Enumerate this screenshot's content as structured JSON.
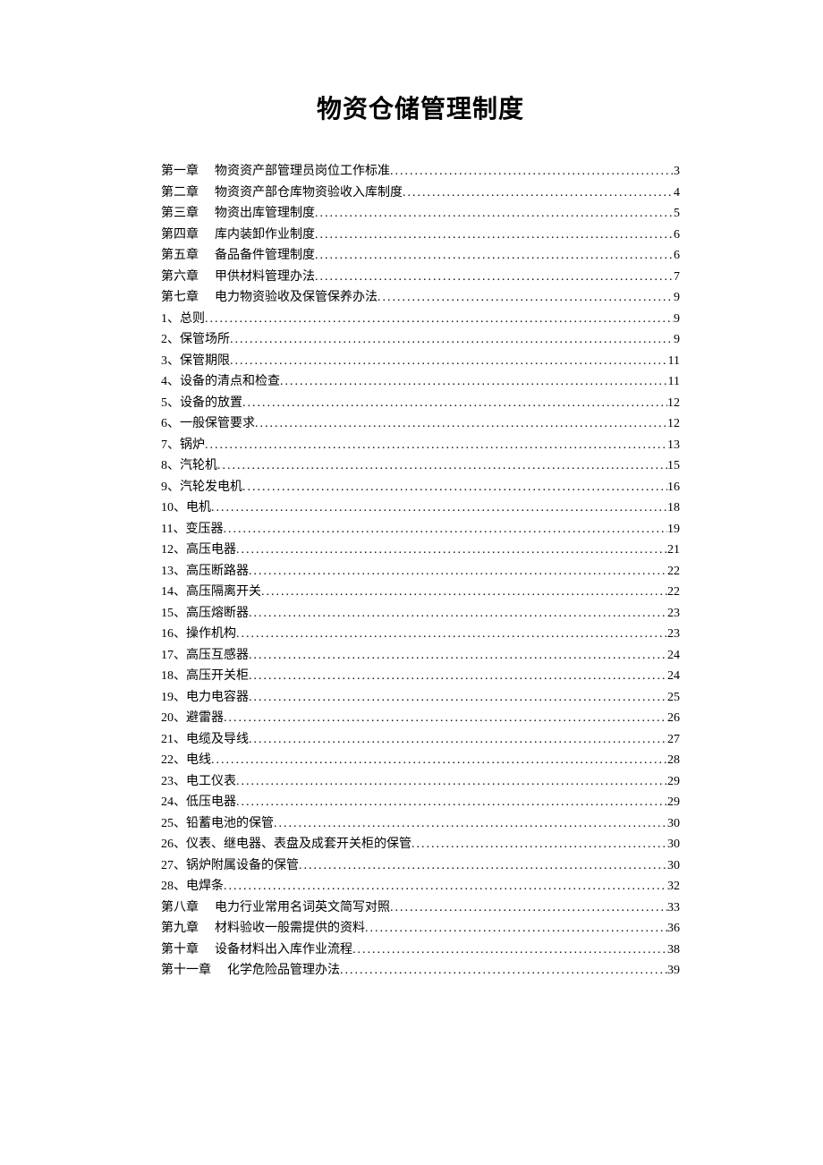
{
  "title": "物资仓储管理制度",
  "toc": [
    {
      "label": "第一章",
      "text": "物资资产部管理员岗位工作标准",
      "page": "3",
      "isChapter": true
    },
    {
      "label": "第二章",
      "text": "物资资产部仓库物资验收入库制度",
      "page": "4",
      "isChapter": true
    },
    {
      "label": "第三章",
      "text": "物资出库管理制度",
      "page": "5",
      "isChapter": true
    },
    {
      "label": "第四章",
      "text": "库内装卸作业制度",
      "page": "6",
      "isChapter": true
    },
    {
      "label": "第五章",
      "text": "备品备件管理制度",
      "page": "6",
      "isChapter": true
    },
    {
      "label": "第六章",
      "text": "甲供材料管理办法",
      "page": "7",
      "isChapter": true
    },
    {
      "label": "第七章",
      "text": "电力物资验收及保管保养办法",
      "page": "9",
      "isChapter": true
    },
    {
      "label": "1、",
      "text": "总则",
      "page": "9",
      "isChapter": false
    },
    {
      "label": "2、",
      "text": "保管场所",
      "page": "9",
      "isChapter": false
    },
    {
      "label": "3、",
      "text": "保管期限",
      "page": "11",
      "isChapter": false
    },
    {
      "label": "4、",
      "text": "设备的清点和检查",
      "page": "11",
      "isChapter": false
    },
    {
      "label": "5、",
      "text": "设备的放置",
      "page": "12",
      "isChapter": false
    },
    {
      "label": "6、",
      "text": "一般保管要求",
      "page": "12",
      "isChapter": false
    },
    {
      "label": "7、",
      "text": "锅炉",
      "page": "13",
      "isChapter": false
    },
    {
      "label": "8、",
      "text": "汽轮机",
      "page": "15",
      "isChapter": false
    },
    {
      "label": "9、",
      "text": "汽轮发电机",
      "page": "16",
      "isChapter": false
    },
    {
      "label": "10、",
      "text": "电机",
      "page": "18",
      "isChapter": false
    },
    {
      "label": "11、",
      "text": "变压器",
      "page": "19",
      "isChapter": false
    },
    {
      "label": "12、",
      "text": "高压电器",
      "page": "21",
      "isChapter": false
    },
    {
      "label": "13、",
      "text": "高压断路器",
      "page": "22",
      "isChapter": false
    },
    {
      "label": "14、",
      "text": "高压隔离开关",
      "page": "22",
      "isChapter": false
    },
    {
      "label": "15、",
      "text": "高压熔断器",
      "page": "23",
      "isChapter": false
    },
    {
      "label": "16、",
      "text": "操作机构",
      "page": "23",
      "isChapter": false
    },
    {
      "label": "17、",
      "text": "高压互感器",
      "page": "24",
      "isChapter": false
    },
    {
      "label": "18、",
      "text": "高压开关柜",
      "page": "24",
      "isChapter": false
    },
    {
      "label": "19、",
      "text": "电力电容器",
      "page": "25",
      "isChapter": false
    },
    {
      "label": "20、",
      "text": "避雷器",
      "page": "26",
      "isChapter": false
    },
    {
      "label": "21、",
      "text": "电缆及导线",
      "page": "27",
      "isChapter": false
    },
    {
      "label": "22、",
      "text": "电线",
      "page": "28",
      "isChapter": false
    },
    {
      "label": "23、",
      "text": "电工仪表",
      "page": "29",
      "isChapter": false
    },
    {
      "label": "24、",
      "text": "低压电器",
      "page": "29",
      "isChapter": false
    },
    {
      "label": "25、",
      "text": "铅蓄电池的保管",
      "page": "30",
      "isChapter": false
    },
    {
      "label": "26、",
      "text": "仪表、继电器、表盘及成套开关柜的保管",
      "page": "30",
      "isChapter": false
    },
    {
      "label": "27、",
      "text": "锅炉附属设备的保管",
      "page": "30",
      "isChapter": false
    },
    {
      "label": "28、",
      "text": "电焊条",
      "page": "32",
      "isChapter": false
    },
    {
      "label": "第八章",
      "text": "电力行业常用名词英文简写对照",
      "page": "33",
      "isChapter": true
    },
    {
      "label": "第九章",
      "text": "材料验收一般需提供的资料",
      "page": "36",
      "isChapter": true
    },
    {
      "label": "第十章",
      "text": "设备材料出入库作业流程",
      "page": "38",
      "isChapter": true
    },
    {
      "label": "第十一章",
      "text": "化学危险品管理办法",
      "page": "39",
      "isChapter": true
    }
  ]
}
